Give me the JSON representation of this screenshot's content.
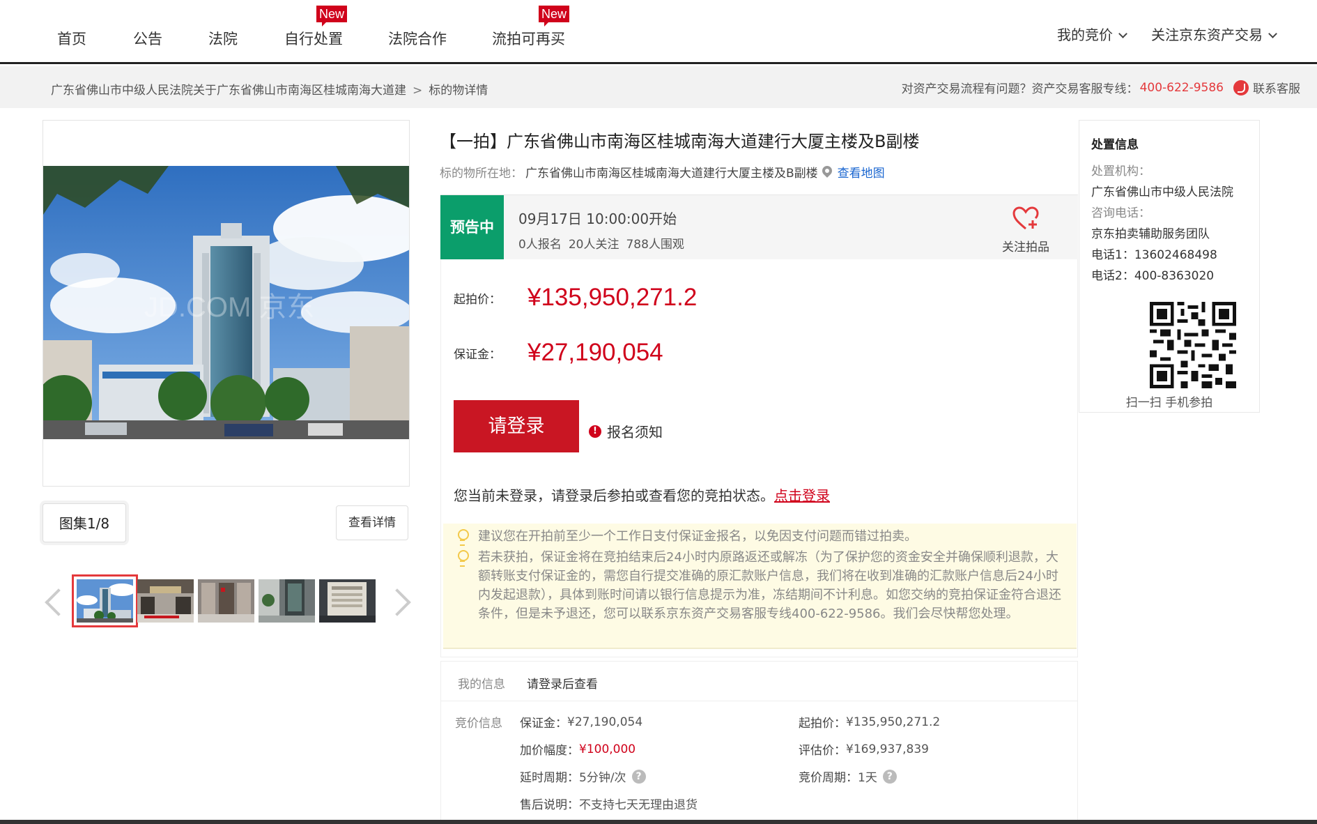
{
  "nav": {
    "items": [
      {
        "label": "首页"
      },
      {
        "label": "公告"
      },
      {
        "label": "法院"
      },
      {
        "label": "自行处置",
        "badge": "New"
      },
      {
        "label": "法院合作"
      },
      {
        "label": "流拍可再买",
        "badge": "New"
      }
    ],
    "my_bids": "我的竞价",
    "follow_jd": "关注京东资产交易"
  },
  "breadcrumb": {
    "parent": "广东省佛山市中级人民法院关于广东省佛山市南海区桂城南海大道建",
    "separator": ">",
    "current": "标的物详情"
  },
  "help": {
    "question": "对资产交易流程有问题？资产交易客服专线：",
    "phone": "400-622-9586",
    "contact": "联系客服"
  },
  "gallery": {
    "watermark": "JD.COM 京东",
    "album_label": "图集1/8",
    "detail_label": "查看详情",
    "thumbs": [
      "thumb-1",
      "thumb-2",
      "thumb-3",
      "thumb-4",
      "thumb-5"
    ]
  },
  "item": {
    "title": "【一拍】广东省佛山市南海区桂城南海大道建行大厦主楼及B副楼",
    "location_label": "标的物所在地：",
    "location": "广东省佛山市南海区桂城南海大道建行大厦主楼及B副楼",
    "map_link": "查看地图"
  },
  "status": {
    "tag": "预告中",
    "start_time": "09月17日 10:00:00开始",
    "registered": "0人报名",
    "followers": "20人关注",
    "viewers": "788人围观",
    "follow_label": "关注拍品"
  },
  "price": {
    "start_label": "起拍价：",
    "start_value": "¥135,950,271.2",
    "deposit_label": "保证金：",
    "deposit_value": "¥27,190,054",
    "login_button": "请登录",
    "notice": "报名须知",
    "login_tip": "您当前未登录，请登录后参拍或查看您的竞拍状态。",
    "login_link": "点击登录"
  },
  "tips": [
    "建议您在开拍前至少一个工作日支付保证金报名，以免因支付问题而错过拍卖。",
    "若未获拍，保证金将在竞拍结束后24小时内原路返还或解冻（为了保护您的资金安全并确保顺利退款，大额转账支付保证金的，需您自行提交准确的原汇款账户信息，我们将在收到准确的汇款账户信息后24小时内发起退款），具体到账时间请以银行信息提示为准，冻结期间不计利息。如您交纳的竞拍保证金符合退还条件，但是未予退还，您可以联系京东资产交易客服专线400-622-9586。我们会尽快帮您处理。"
  ],
  "my_info": {
    "label": "我的信息",
    "value": "请登录后查看"
  },
  "bid_info": {
    "label": "竞价信息",
    "deposit_k": "保证金：",
    "deposit_v": "¥27,190,054",
    "start_k": "起拍价：",
    "start_v": "¥135,950,271.2",
    "increment_k": "加价幅度：",
    "increment_v": "¥100,000",
    "appraisal_k": "评估价：",
    "appraisal_v": "¥169,937,839",
    "delay_k": "延时周期：",
    "delay_v": "5分钟/次",
    "cycle_k": "竞价周期：",
    "cycle_v": "1天",
    "aftersale_k": "售后说明：",
    "aftersale_v": "不支持七天无理由退货"
  },
  "disposal": {
    "title": "处置信息",
    "org_label": "处置机构：",
    "org": "广东省佛山市中级人民法院",
    "phone_label": "咨询电话：",
    "team": "京东拍卖辅助服务团队",
    "phone1": "电话1：13602468498",
    "phone2": "电话2：400-8363020",
    "scan": "扫一扫 手机参拍"
  },
  "colors": {
    "accent_red": "#c91623",
    "price_red": "#d0021b",
    "status_green": "#0b9e6b",
    "link_blue": "#1a66d0"
  },
  "icons": [
    "chevron-down-icon",
    "customer-service-icon",
    "map-pin-icon",
    "heart-plus-icon",
    "exclamation-icon",
    "bulb-icon",
    "question-icon",
    "qr-code-icon",
    "arrow-left-icon",
    "arrow-right-icon"
  ]
}
